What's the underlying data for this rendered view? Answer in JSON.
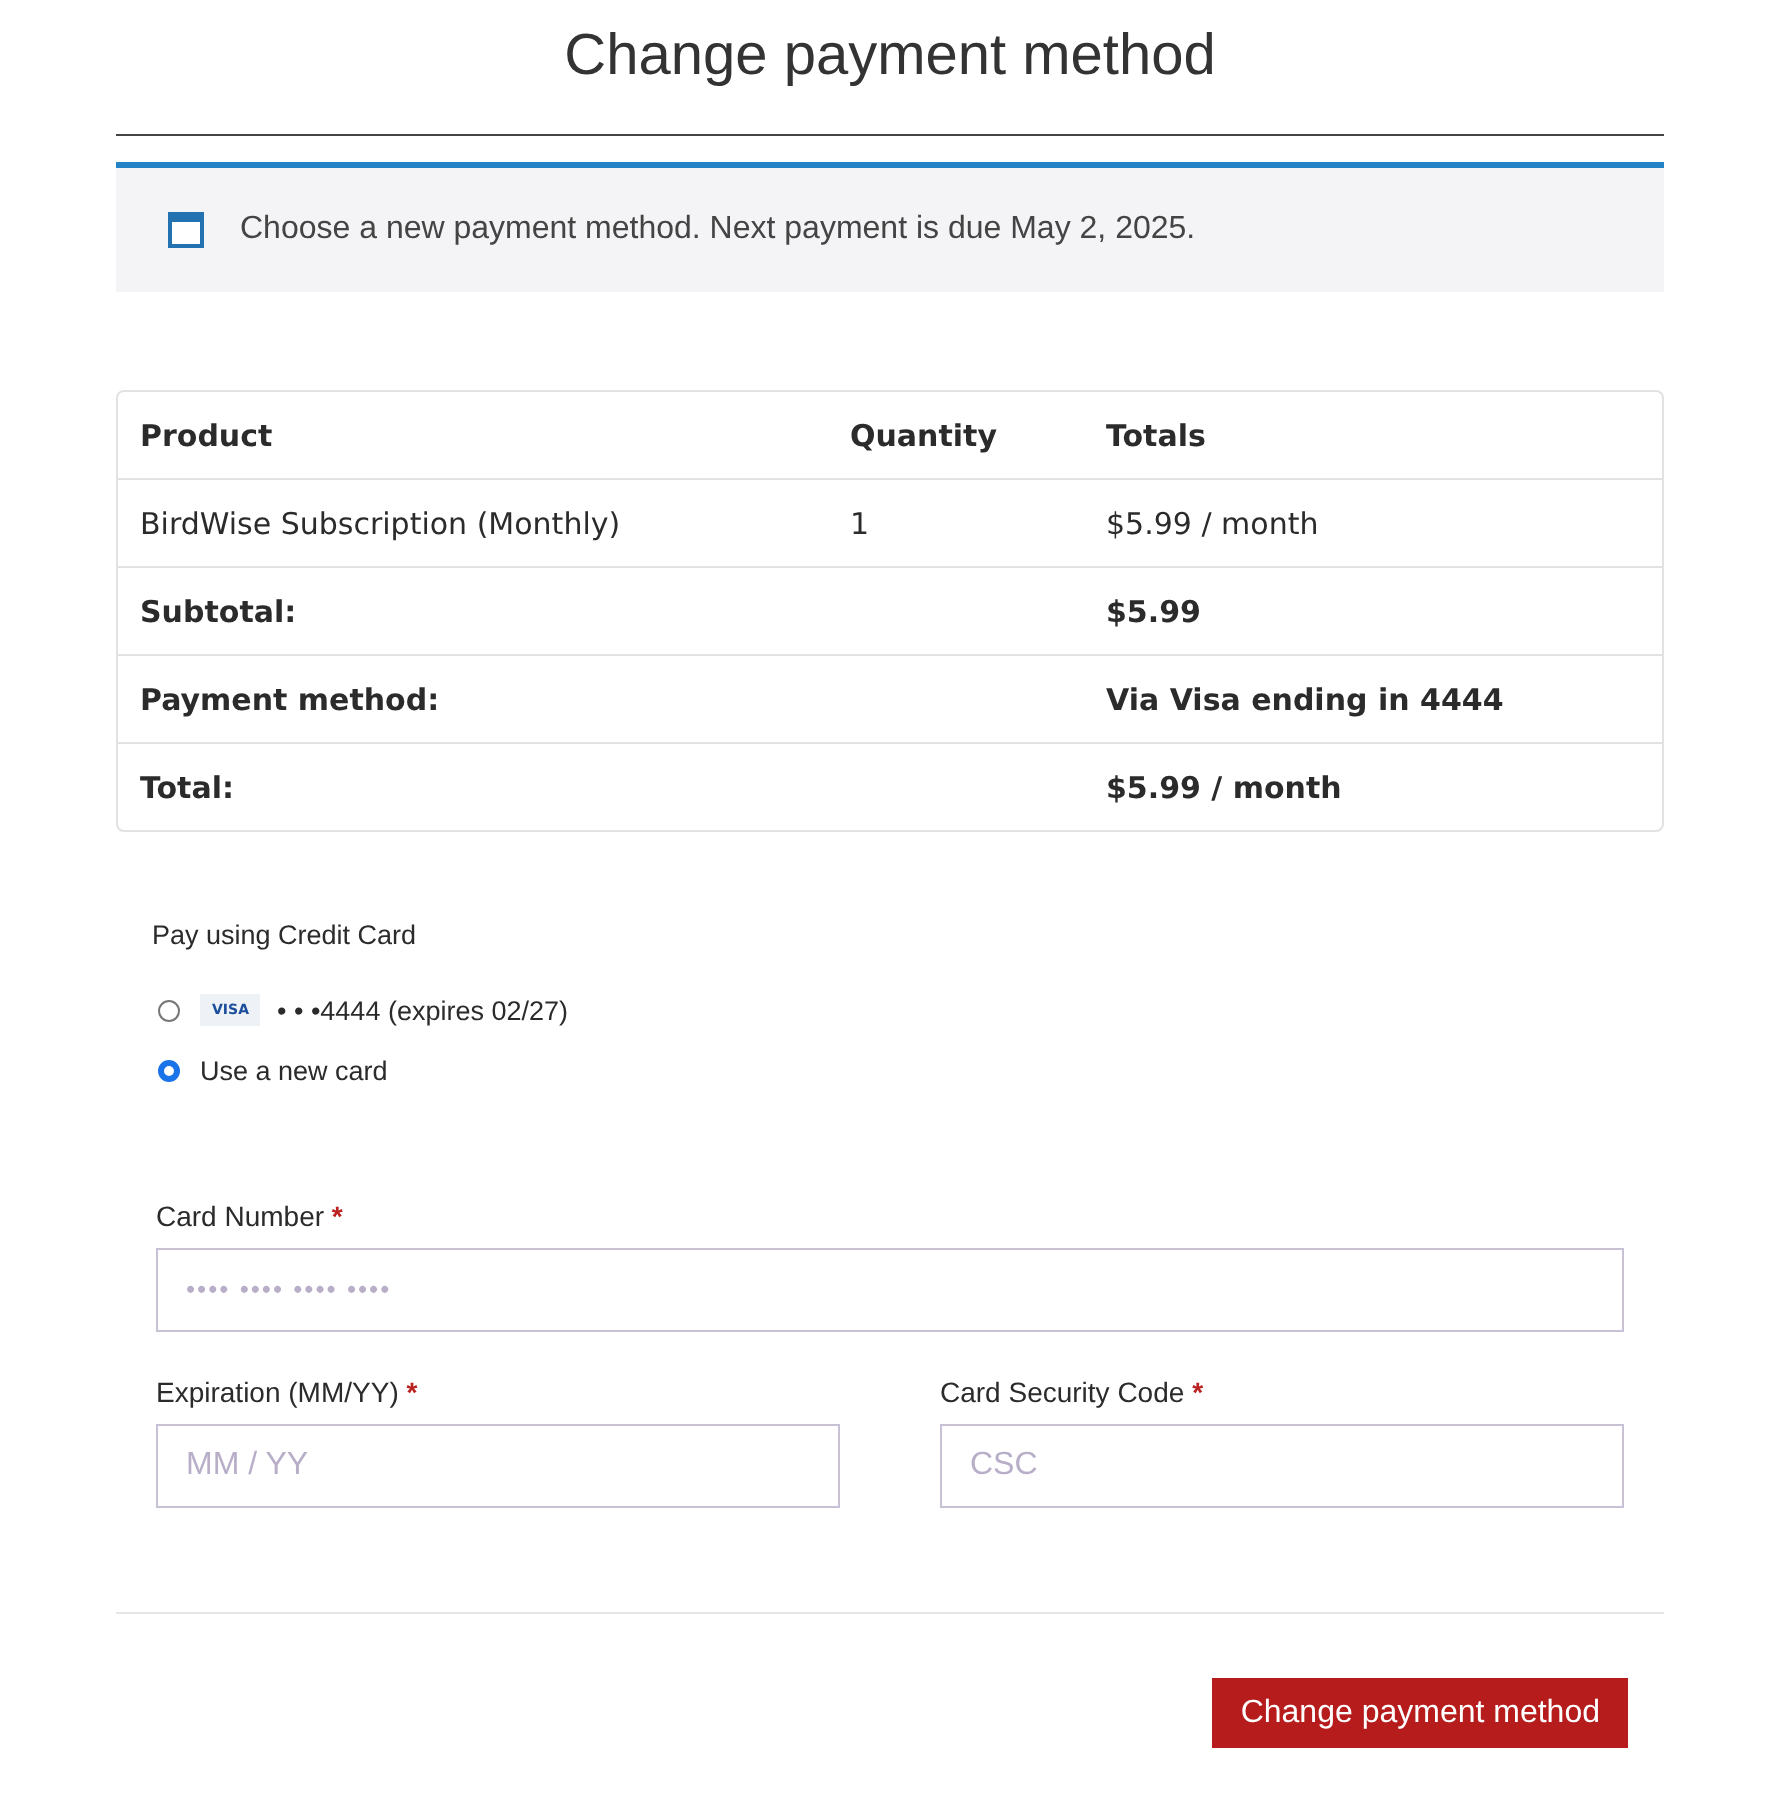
{
  "title": "Change payment method",
  "notice": {
    "text": "Choose a new payment method. Next payment is due May 2, 2025."
  },
  "table": {
    "columns": [
      "Product",
      "Quantity",
      "Totals"
    ],
    "rows": [
      {
        "kind": "item",
        "cells": [
          "BirdWise Subscription (Monthly)",
          "1",
          "$5.99 / month"
        ]
      },
      {
        "kind": "summary",
        "cells": [
          "Subtotal:",
          "$5.99"
        ]
      },
      {
        "kind": "summary",
        "cells": [
          "Payment method:",
          "Via Visa ending in 4444"
        ]
      },
      {
        "kind": "summary",
        "cells": [
          "Total:",
          "$5.99 / month"
        ]
      }
    ]
  },
  "payment": {
    "heading": "Pay using Credit Card",
    "options": [
      {
        "kind": "saved",
        "brand": "VISA",
        "label": "• • •4444 (expires 02/27)",
        "selected": false
      },
      {
        "kind": "new",
        "label": "Use a new card",
        "selected": true
      }
    ]
  },
  "fields": [
    {
      "label": "Card Number",
      "required": "*",
      "placeholder": "•••• •••• •••• ••••"
    },
    {
      "label": "Expiration (MM/YY)",
      "required": "*",
      "placeholder": "MM / YY"
    },
    {
      "label": "Card Security Code",
      "required": "*",
      "placeholder": "CSC"
    }
  ],
  "button": {
    "label": "Change payment method"
  }
}
